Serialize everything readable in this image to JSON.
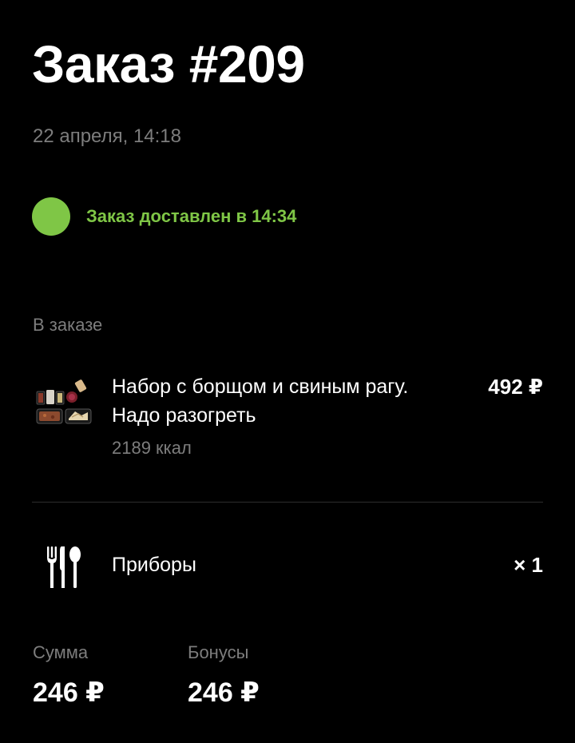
{
  "order": {
    "title": "Заказ #209",
    "date": "22 апреля, 14:18"
  },
  "status": {
    "text": "Заказ доставлен в 14:34",
    "color": "#7fc646"
  },
  "items_section": {
    "label": "В заказе",
    "items": [
      {
        "name": "Набор с борщом и свиным рагу. Надо разогреть",
        "kcal": "2189 ккал",
        "price": "492 ₽",
        "icon": "meal-set-image"
      }
    ]
  },
  "cutlery": {
    "label": "Приборы",
    "quantity": "× 1",
    "icon": "cutlery-icon"
  },
  "totals": {
    "sum_label": "Сумма",
    "sum_value": "246 ₽",
    "bonus_label": "Бонусы",
    "bonus_value": "246 ₽"
  },
  "colors": {
    "background": "#000000",
    "text": "#ffffff",
    "secondary_text": "#7d7d7d",
    "accent": "#7fc646"
  }
}
